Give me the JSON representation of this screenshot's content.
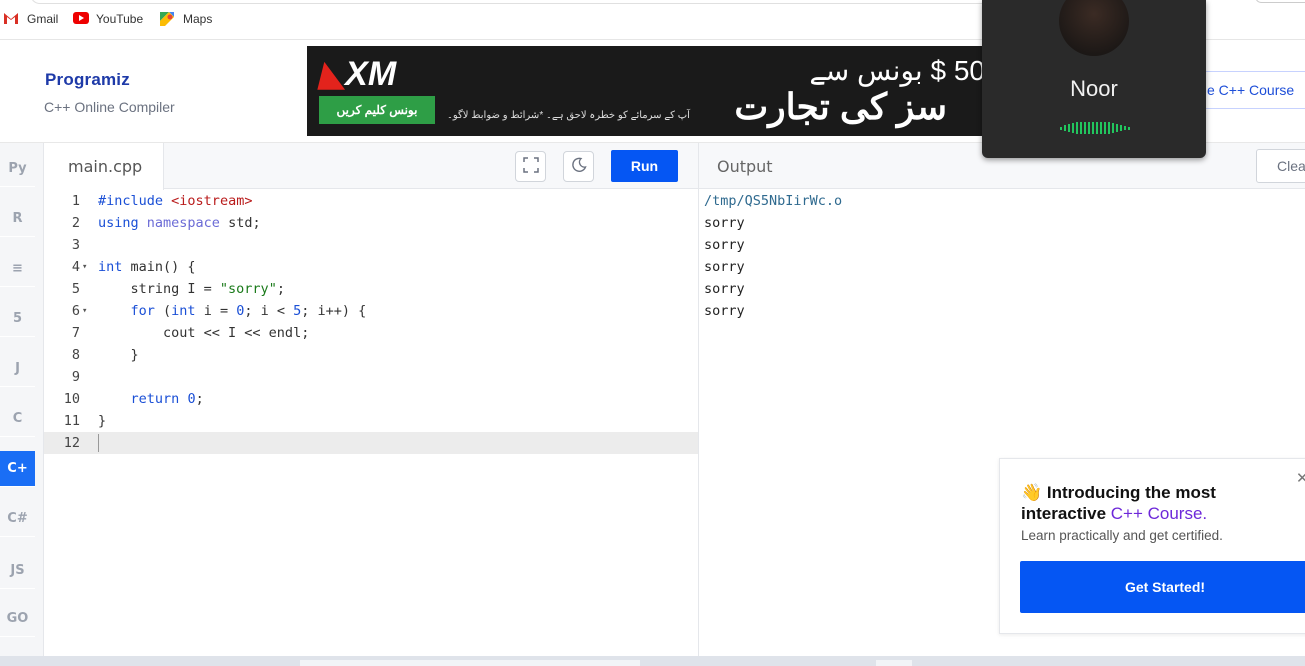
{
  "bookmarks": [
    {
      "label": "Gmail",
      "icon": "gmail-icon"
    },
    {
      "label": "YouTube",
      "icon": "youtube-icon"
    },
    {
      "label": "Maps",
      "icon": "maps-icon"
    }
  ],
  "header": {
    "logo": "Programiz",
    "subtitle": "C++ Online Compiler",
    "course_button": "e C++ Course"
  },
  "ad": {
    "brand": "XM",
    "claim_button": "بونس کلیم کریں",
    "disclaimer": "آپ کے سرمائے کو خطرہ لاحق ہے۔ *شرائط و ضوابط لاگو۔",
    "headline_1": "50 $ بونس سے",
    "headline_2": "سز کی تجارت"
  },
  "languages": [
    {
      "id": "python",
      "glyph": "Py"
    },
    {
      "id": "r",
      "glyph": "R"
    },
    {
      "id": "sql",
      "glyph": "≡"
    },
    {
      "id": "html",
      "glyph": "5"
    },
    {
      "id": "java",
      "glyph": "J"
    },
    {
      "id": "c",
      "glyph": "C"
    },
    {
      "id": "cpp",
      "glyph": "C+",
      "active": true
    },
    {
      "id": "csharp",
      "glyph": "C#"
    },
    {
      "id": "js",
      "glyph": "JS"
    },
    {
      "id": "go",
      "glyph": "GO"
    }
  ],
  "editor": {
    "filename": "main.cpp",
    "run_label": "Run",
    "fullscreen_icon": "fullscreen-icon",
    "theme_icon": "moon-icon"
  },
  "code_lines": [
    "#include <iostream>",
    "using namespace std;",
    "",
    "int main() {",
    "    string I = \"sorry\";",
    "    for (int i = 0; i < 5; i++) {",
    "        cout << I << endl;",
    "    }",
    "",
    "    return 0;",
    "}",
    ""
  ],
  "output": {
    "title": "Output",
    "clear_label": "Clea",
    "lines": [
      "/tmp/QS5NbIirWc.o",
      "sorry",
      "sorry",
      "sorry",
      "sorry",
      "sorry"
    ]
  },
  "call": {
    "name": "Noor"
  },
  "promo": {
    "emoji": "👋",
    "title_line1": "Introducing the most",
    "title_line2_pre": "interactive ",
    "title_line2_accent": "C++ Course.",
    "subtitle": "Learn practically and get certified.",
    "cta": "Get Started!"
  },
  "colors": {
    "accent": "#0556f3",
    "active_lang": "#1a6ef5",
    "course_accent": "#6d28d9"
  }
}
